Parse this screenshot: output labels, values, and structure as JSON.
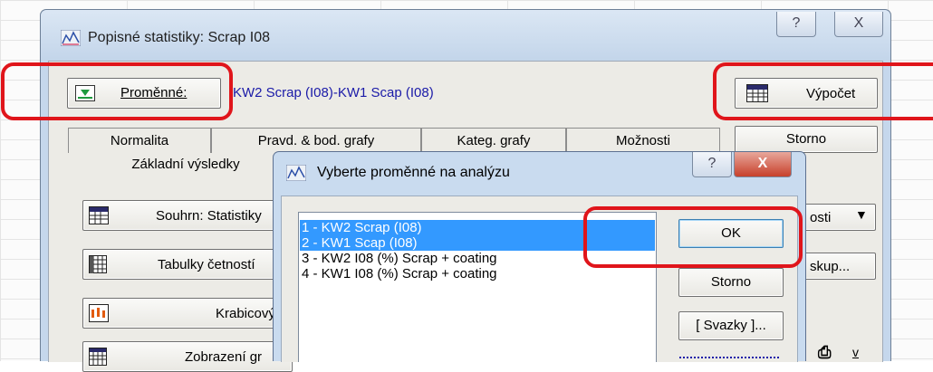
{
  "main_window": {
    "title": "Popisné statistiky: Scrap I08",
    "help_glyph": "?",
    "close_glyph": "X",
    "variables_button": "Proměnné:",
    "variables_value": "KW2 Scrap (I08)-KW1 Scap (I08)",
    "compute_button": "Výpočet",
    "cancel_button": "Storno",
    "tabs_row1": [
      "Normalita",
      "Pravd. & bod. grafy",
      "Kateg. grafy",
      "Možnosti"
    ],
    "tab_active": "Základní výsledky",
    "options_dropdown": "osti",
    "group_button": "skup...",
    "side_buttons": [
      "Souhrn: Statistiky",
      "Tabulky četností",
      "Krabicový",
      "Zobrazení gr"
    ],
    "bottom_right_label": "v"
  },
  "dialog": {
    "title": "Vyberte proměnné na analýzu",
    "help_glyph": "?",
    "close_glyph": "X",
    "variables": [
      {
        "label": "1 - KW2 Scrap (I08)",
        "selected": true
      },
      {
        "label": "2 - KW1 Scap (I08)",
        "selected": true
      },
      {
        "label": "3 - KW2 I08 (%) Scrap + coating",
        "selected": false
      },
      {
        "label": "4 - KW1 I08 (%) Scrap + coating",
        "selected": false
      }
    ],
    "ok_button": "OK",
    "cancel_button": "Storno",
    "links_button": "[ Svazky ]..."
  },
  "colors": {
    "highlight": "#e0151b",
    "selection": "#3399ff",
    "link_text": "#1a1aa8"
  }
}
